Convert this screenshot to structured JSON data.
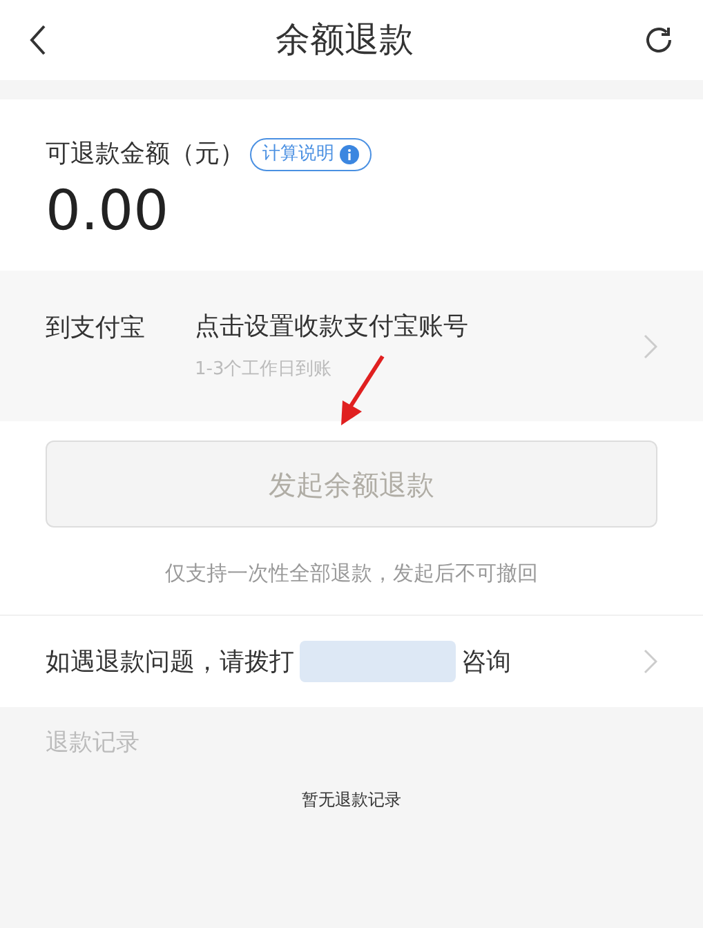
{
  "header": {
    "title": "余额退款"
  },
  "balance": {
    "label": "可退款金额（元）",
    "info_badge": "计算说明",
    "amount": "0.00"
  },
  "payout": {
    "label": "到支付宝",
    "value": "点击设置收款支付宝账号",
    "hint": "1-3个工作日到账"
  },
  "refund_button": {
    "label": "发起余额退款",
    "disabled": true
  },
  "note": "仅支持一次性全部退款，发起后不可撤回",
  "contact": {
    "before": "如遇退款问题，请拨打",
    "after": "咨询"
  },
  "records": {
    "title": "退款记录",
    "empty": "暂无退款记录"
  }
}
